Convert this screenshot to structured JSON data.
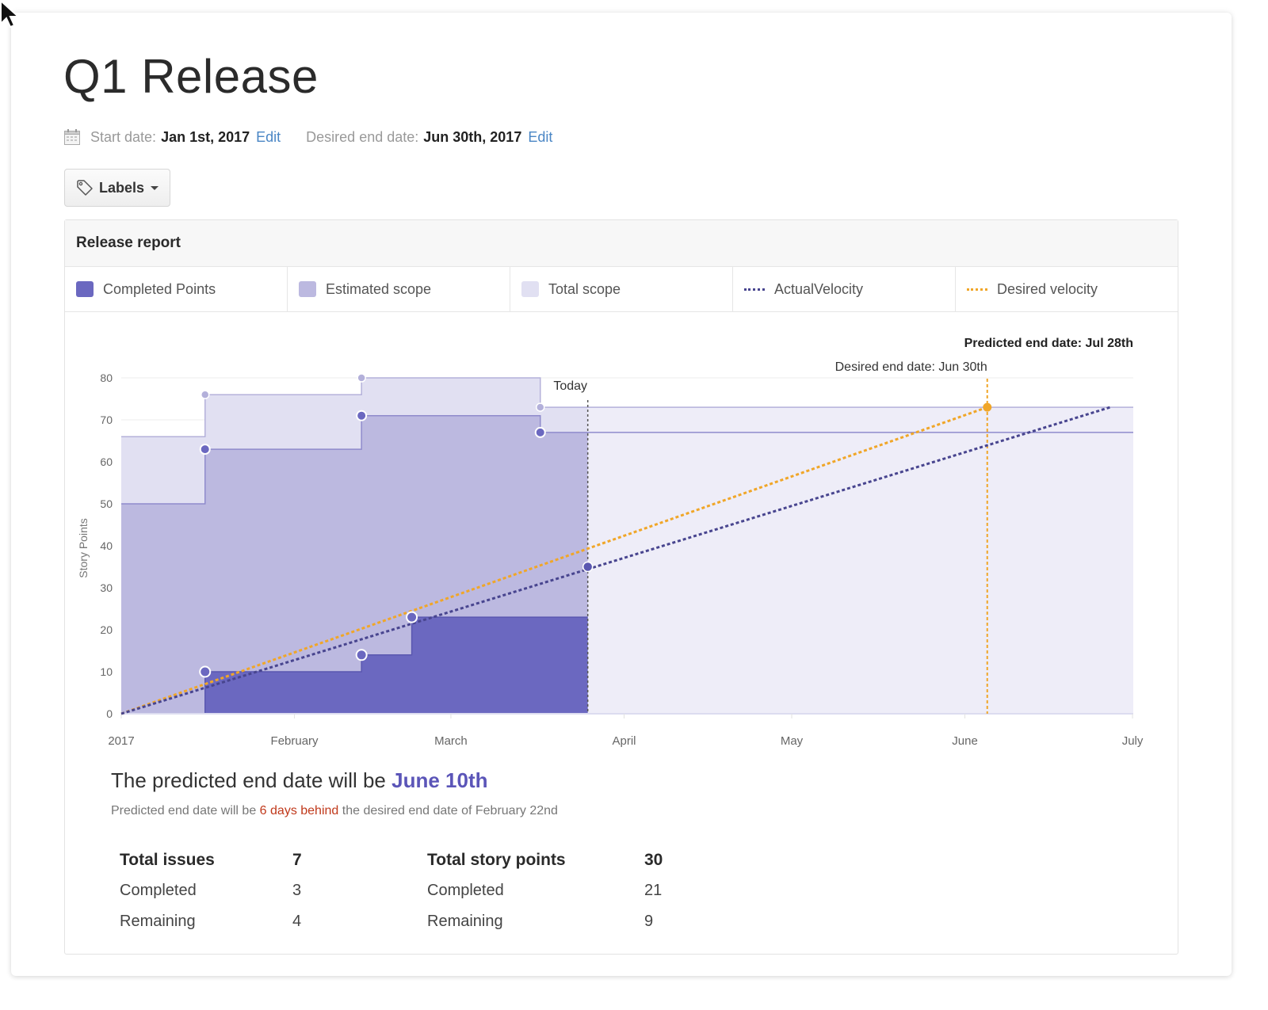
{
  "page": {
    "title": "Q1 Release",
    "start_date_label": "Start date:",
    "start_date_value": "Jan 1st, 2017",
    "desired_end_label": "Desired end date:",
    "desired_end_value": "Jun 30th, 2017",
    "edit_label": "Edit",
    "labels_button": "Labels"
  },
  "report": {
    "title": "Release report",
    "legend": [
      {
        "label": "Completed Points",
        "kind": "swatch",
        "color": "#6b68c0"
      },
      {
        "label": "Estimated scope",
        "kind": "swatch",
        "color": "#bcb9e0"
      },
      {
        "label": "Total scope",
        "kind": "swatch",
        "color": "#e1e0f2"
      },
      {
        "label": "ActualVelocity",
        "kind": "dash",
        "color": "#48458f"
      },
      {
        "label": "Desired velocity",
        "kind": "dash",
        "color": "#f0a628"
      }
    ],
    "summary": {
      "headline_prefix": "The predicted end date will be ",
      "headline_date": "June 10th",
      "sub_prefix": "Predicted end date will be ",
      "sub_late": "6 days behind",
      "sub_suffix": " the desired end date of February 22nd"
    },
    "stats": [
      {
        "rows": [
          {
            "label": "Total issues",
            "value": "7"
          },
          {
            "label": "Completed",
            "value": "3"
          },
          {
            "label": "Remaining",
            "value": "4"
          }
        ]
      },
      {
        "rows": [
          {
            "label": "Total story points",
            "value": "30"
          },
          {
            "label": "Completed",
            "value": "21"
          },
          {
            "label": "Remaining",
            "value": "9"
          }
        ]
      }
    ]
  },
  "chart_data": {
    "type": "area",
    "title": "",
    "xlabel": "",
    "ylabel": "Story Points",
    "x_unit": "days since Jan 1, 2017",
    "xlim": [
      0,
      180
    ],
    "ylim": [
      0,
      80
    ],
    "yticks": [
      0,
      10,
      20,
      30,
      40,
      50,
      60,
      70,
      80
    ],
    "xticks": [
      {
        "x": 0,
        "label": "2017"
      },
      {
        "x": 31,
        "label": "February"
      },
      {
        "x": 59,
        "label": "March"
      },
      {
        "x": 90,
        "label": "April"
      },
      {
        "x": 120,
        "label": "May"
      },
      {
        "x": 151,
        "label": "June"
      },
      {
        "x": 181,
        "label": "July"
      }
    ],
    "grid": true,
    "legend_position": "top",
    "series": [
      {
        "name": "Total scope",
        "type": "step-area",
        "color": "#e1e0f2",
        "line": "#b4b1da",
        "points": [
          [
            0,
            66
          ],
          [
            15,
            76
          ],
          [
            43,
            80
          ],
          [
            75,
            73
          ],
          [
            177,
            73
          ]
        ],
        "markers": [
          [
            15,
            76
          ],
          [
            43,
            80
          ],
          [
            75,
            73
          ]
        ]
      },
      {
        "name": "Estimated scope",
        "type": "step-area",
        "color": "#bcb9e0",
        "line": "#8f8bcc",
        "points": [
          [
            0,
            50
          ],
          [
            15,
            63
          ],
          [
            43,
            71
          ],
          [
            75,
            67
          ],
          [
            177,
            67
          ]
        ],
        "markers": [
          [
            15,
            63
          ],
          [
            43,
            71
          ],
          [
            75,
            67
          ]
        ]
      },
      {
        "name": "Completed Points",
        "type": "step-area",
        "color": "#6b68c0",
        "line": "#5a57b0",
        "points": [
          [
            0,
            0
          ],
          [
            15,
            10
          ],
          [
            43,
            14
          ],
          [
            52,
            23
          ],
          [
            83.5,
            23
          ]
        ],
        "markers": [
          [
            15,
            10
          ],
          [
            43,
            14
          ],
          [
            52,
            23
          ]
        ]
      },
      {
        "name": "ActualVelocity",
        "type": "dashed-line",
        "color": "#48458f",
        "points": [
          [
            0,
            0
          ],
          [
            177,
            73
          ]
        ],
        "markers": [
          [
            83.5,
            35
          ]
        ]
      },
      {
        "name": "Desired velocity",
        "type": "dashed-line",
        "color": "#f0a628",
        "points": [
          [
            0,
            0
          ],
          [
            155,
            73
          ]
        ],
        "markers": [
          [
            155,
            73
          ]
        ]
      }
    ],
    "annotations": [
      {
        "type": "vline",
        "x": 83.5,
        "label": "Today",
        "color": "#555"
      },
      {
        "type": "vline",
        "x": 155,
        "label": "Desired end date: Jun 30th",
        "color": "#f0a628"
      },
      {
        "type": "text",
        "label": "Predicted end date: Jul 28th",
        "position": "top-right"
      }
    ],
    "future_shading_color": "#eeedf8"
  }
}
